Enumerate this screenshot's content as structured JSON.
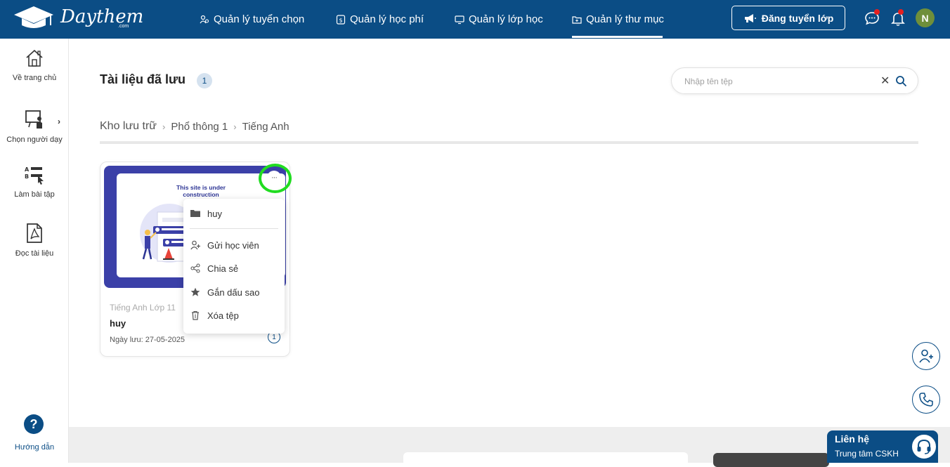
{
  "header": {
    "logo_text": "Daythem",
    "logo_sub": ".com",
    "nav": [
      {
        "label": "Quản lý tuyển chọn",
        "icon": "users-search-icon"
      },
      {
        "label": "Quản lý học phí",
        "icon": "dollar-icon"
      },
      {
        "label": "Quản lý lớp học",
        "icon": "monitor-icon"
      },
      {
        "label": "Quản lý thư mục",
        "icon": "folder-icon",
        "active": true
      }
    ],
    "post_button": "Đăng tuyển lớp",
    "avatar_initial": "N",
    "colors": {
      "primary": "#0b4d85",
      "notification_dot": "#e52020"
    }
  },
  "sidebar": {
    "items": [
      {
        "label": "Về trang chủ",
        "icon": "home-icon"
      },
      {
        "label": "Chọn người dạy",
        "icon": "teacher-board-icon"
      },
      {
        "label": "Làm bài tập",
        "icon": "exercise-list-icon"
      },
      {
        "label": "Đọc tài liệu",
        "icon": "pdf-icon"
      }
    ],
    "help_label": "Hướng dẫn",
    "help_symbol": "?"
  },
  "main": {
    "title": "Tài liệu đã lưu",
    "count": "1",
    "search": {
      "placeholder": "Nhập tên tệp",
      "value": ""
    },
    "breadcrumb": [
      "Kho lưu trữ",
      "Phổ thông 1",
      "Tiếng Anh"
    ],
    "card": {
      "thumb_text": "This site is under construction",
      "subject": "Tiếng Anh Lớp 11",
      "name": "huy",
      "saved_date": "Ngày lưu: 27-05-2025",
      "info_count": "1",
      "more_symbol": "···"
    },
    "context_menu": {
      "folder_name": "huy",
      "items": [
        {
          "label": "Gửi học viên",
          "icon": "user-add-icon"
        },
        {
          "label": "Chia sẻ",
          "icon": "share-icon"
        },
        {
          "label": "Gắn dấu sao",
          "icon": "star-icon"
        },
        {
          "label": "Xóa tệp",
          "icon": "trash-icon"
        }
      ]
    }
  },
  "contact": {
    "title": "Liên hệ",
    "subtitle": "Trung tâm CSKH"
  }
}
